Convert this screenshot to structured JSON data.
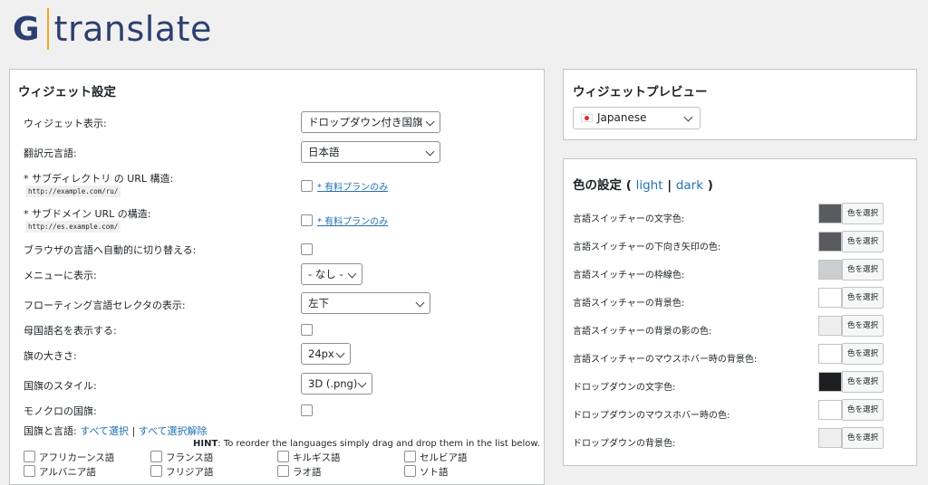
{
  "brand": {
    "g": "G",
    "name": "translate"
  },
  "settings": {
    "title": "ウィジェット設定",
    "rows": [
      {
        "label": "ウィジェット表示:",
        "value": "ドロップダウン付き国旗"
      },
      {
        "label": "翻訳元言語:",
        "value": "日本語"
      },
      {
        "label": "* サブディレクトリ の URL 構造:",
        "code": "http://example.com/ru/",
        "paid": "* 有料プランのみ"
      },
      {
        "label": "* サブドメイン URL の構造:",
        "code": "http://es.example.com/",
        "paid": "* 有料プランのみ"
      },
      {
        "label": "ブラウザの言語へ自動的に切り替える:"
      },
      {
        "label": "メニューに表示:",
        "value": "- なし -"
      },
      {
        "label": "フローティング言語セレクタの表示:",
        "value": "左下"
      },
      {
        "label": "母国語名を表示する:"
      },
      {
        "label": "旗の大きさ:",
        "value": "24px"
      },
      {
        "label": "国旗のスタイル:",
        "value": "3D (.png)"
      },
      {
        "label": "モノクロの国旗:"
      }
    ],
    "langs_line": {
      "label": "国旗と言語:",
      "select_all": "すべて選択",
      "sep": "|",
      "deselect_all": "すべて選択解除"
    },
    "hint": {
      "bold": "HINT",
      "text": ": To reorder the languages simply drag and drop them in the list below."
    },
    "languages": [
      "アフリカーンス語",
      "フランス語",
      "キルギス語",
      "セルビア語",
      "アルバニア語",
      "フリジア語",
      "ラオ語",
      "ソト語"
    ]
  },
  "preview": {
    "title": "ウィジェットプレビュー",
    "language": "Japanese"
  },
  "colors": {
    "title": "色の設定",
    "open": "(",
    "light": "light",
    "sep": "|",
    "dark": "dark",
    "close": ")",
    "button_label": "色を選択",
    "rows": [
      {
        "label": "言語スイッチャーの文字色:",
        "color": "#5a5b5e"
      },
      {
        "label": "言語スイッチャーの下向き矢印の色:",
        "color": "#5a5b5e"
      },
      {
        "label": "言語スイッチャーの枠線色:",
        "color": "#cdced0"
      },
      {
        "label": "言語スイッチャーの背景色:",
        "color": "#ffffff"
      },
      {
        "label": "言語スイッチャーの背景の影の色:",
        "color": "#efefef"
      },
      {
        "label": "言語スイッチャーのマウスホバー時の背景色:",
        "color": "#ffffff"
      },
      {
        "label": "ドロップダウンの文字色:",
        "color": "#1d1f21"
      },
      {
        "label": "ドロップダウンのマウスホバー時の色:",
        "color": "#ffffff"
      },
      {
        "label": "ドロップダウンの背景色:",
        "color": "#efefef"
      }
    ]
  }
}
